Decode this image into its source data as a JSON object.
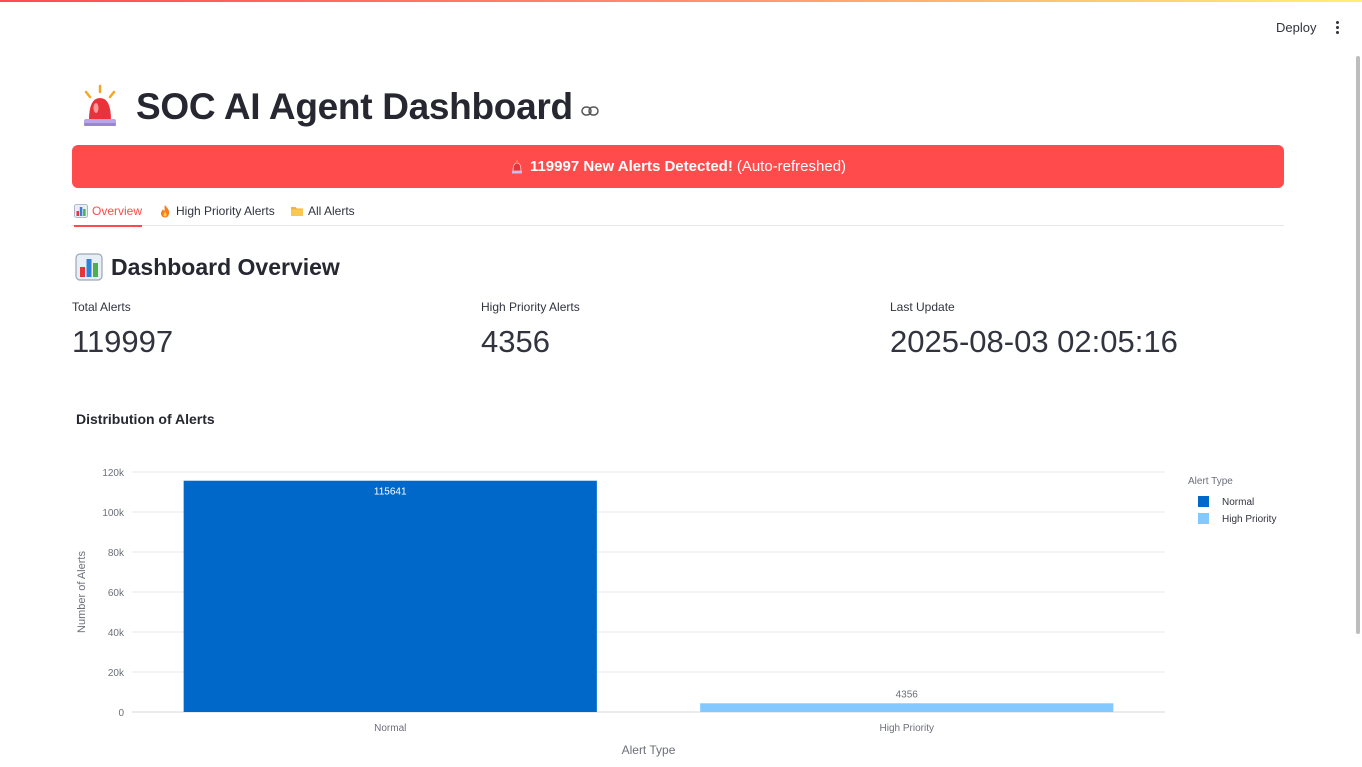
{
  "header": {
    "deploy_label": "Deploy",
    "menu_icon": "more-vertical-icon"
  },
  "title": {
    "icon": "siren-icon",
    "text": "SOC AI Agent Dashboard",
    "link_icon": "link-icon"
  },
  "banner": {
    "icon": "siren-icon",
    "bold_text": "119997 New Alerts Detected!",
    "rest_text": "(Auto-refreshed)",
    "color": "#ff4b4b"
  },
  "tabs": [
    {
      "label": "Overview",
      "icon": "bar-chart-icon",
      "active": true
    },
    {
      "label": "High Priority Alerts",
      "icon": "fire-icon",
      "active": false
    },
    {
      "label": "All Alerts",
      "icon": "folder-icon",
      "active": false
    }
  ],
  "overview": {
    "title": "Dashboard Overview",
    "icon": "bar-chart-icon",
    "metrics": [
      {
        "label": "Total Alerts",
        "value": "119997"
      },
      {
        "label": "High Priority Alerts",
        "value": "4356"
      },
      {
        "label": "Last Update",
        "value": "2025-08-03 02:05:16"
      }
    ]
  },
  "chart_title": "Distribution of Alerts",
  "chart_data": {
    "type": "bar",
    "title": "Distribution of Alerts",
    "categories": [
      "Normal",
      "High Priority"
    ],
    "values": [
      115641,
      4356
    ],
    "data_labels": [
      "115641",
      "4356"
    ],
    "colors": [
      "#0068c9",
      "#83c9ff"
    ],
    "xlabel": "Alert Type",
    "ylabel": "Number of Alerts",
    "ylim": [
      0,
      120000
    ],
    "yticks": [
      0,
      20000,
      40000,
      60000,
      80000,
      100000,
      120000
    ],
    "ytick_labels": [
      "0",
      "20k",
      "40k",
      "60k",
      "80k",
      "100k",
      "120k"
    ],
    "grid": true,
    "legend": {
      "title": "Alert Type",
      "placement": "top-right",
      "entries": [
        "Normal",
        "High Priority"
      ]
    }
  }
}
